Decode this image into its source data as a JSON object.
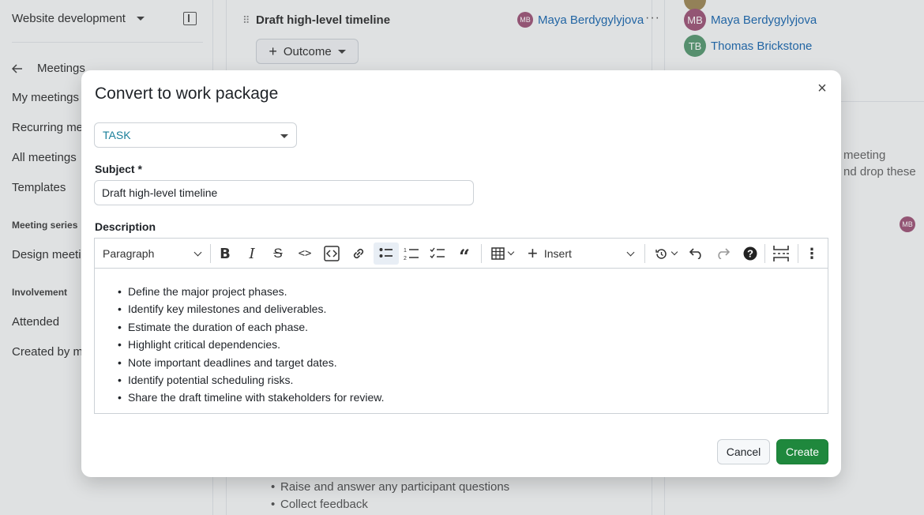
{
  "sidebar": {
    "project": "Website development",
    "back_label": "Meetings",
    "items": [
      {
        "label": "My meetings"
      },
      {
        "label": "Recurring mee"
      },
      {
        "label": "All meetings"
      },
      {
        "label": "Templates"
      }
    ],
    "series_heading": "Meeting series",
    "series_items": [
      {
        "label": "Design meetin"
      }
    ],
    "involvement_heading": "Involvement",
    "involvement_items": [
      {
        "label": "Attended"
      },
      {
        "label": "Created by me"
      }
    ]
  },
  "agenda": {
    "item_title": "Draft high-level timeline",
    "owner_initials": "MB",
    "owner_name": "Maya Berdygylyjova",
    "more_label": "···",
    "outcome_label": "Outcome",
    "bottom_bullets": [
      "Raise and answer any participant questions",
      "Collect feedback"
    ]
  },
  "participants": [
    {
      "initials": "MB",
      "name": "Maya Berdygylyjova",
      "color": "#a0587a"
    },
    {
      "initials": "TB",
      "name": "Thomas Brickstone",
      "color": "#5b9a74"
    }
  ],
  "right_hint": [
    "meeting",
    "nd drop these"
  ],
  "right_avatar_initials": "MB",
  "modal": {
    "title": "Convert to work package",
    "close_label": "×",
    "type_value": "TASK",
    "subject_label": "Subject *",
    "subject_value": "Draft high-level timeline",
    "description_label": "Description",
    "toolbar": {
      "paragraph": "Paragraph",
      "insert": "Insert"
    },
    "description_items": [
      "Define the major project phases.",
      "Identify key milestones and deliverables.",
      "Estimate the duration of each phase.",
      "Highlight critical dependencies.",
      "Note important deadlines and target dates.",
      "Identify potential scheduling risks.",
      "Share the draft timeline with stakeholders for review."
    ],
    "cancel_label": "Cancel",
    "create_label": "Create"
  },
  "colors": {
    "accent_link": "#1f6ab0",
    "type_text": "#1a7f9a",
    "create_button": "#1f883d",
    "avatar_mb": "#a0587a",
    "avatar_tb": "#5b9a74"
  }
}
